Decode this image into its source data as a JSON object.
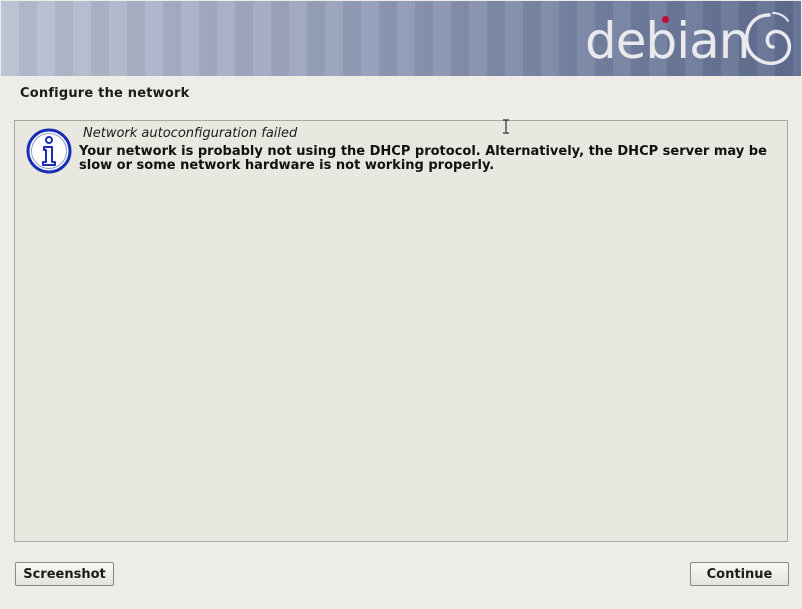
{
  "header": {
    "logo_text": "debian",
    "logo_icon": "debian-swirl-icon",
    "accent": "#c6073a"
  },
  "page": {
    "title": "Configure the network"
  },
  "message": {
    "icon": "info-icon",
    "title": "Network autoconfiguration failed",
    "body": "Your network is probably not using the DHCP protocol. Alternatively, the DHCP server may be slow or some network hardware is not working properly."
  },
  "buttons": {
    "screenshot_label": "Screenshot",
    "continue_label": "Continue"
  }
}
